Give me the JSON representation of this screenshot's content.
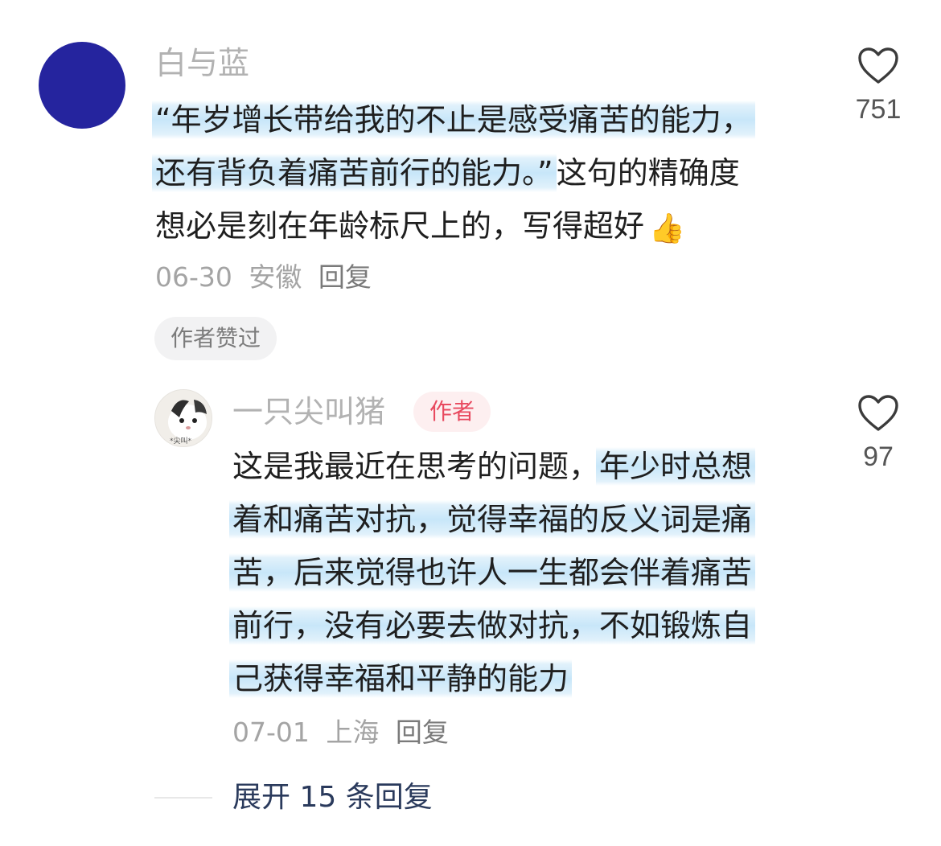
{
  "comment": {
    "username": "白与蓝",
    "avatar_color": "#25249e",
    "lines": [
      "“年岁增长带给我的不止是感受痛苦的能力，",
      "还有背负着痛苦前行的能力。”",
      "这句的精确度",
      "想必是刻在年龄标尺上的，写得超好"
    ],
    "emoji": "thumbs-up-icon",
    "date": "06-30",
    "location": "安徽",
    "reply_label": "回复",
    "like_count": "751",
    "author_liked_label": "作者赞过"
  },
  "reply": {
    "username": "一只尖叫猪",
    "author_badge": "作者",
    "lines": [
      "这是我最近在思考的问题，",
      "年少时总想",
      "着和痛苦对抗，觉得幸福的反义词是痛",
      "苦，后来觉得也许人一生都会伴着痛苦",
      "前行，没有必要去做对抗，不如锻炼自",
      "己获得幸福和平静的能力"
    ],
    "date": "07-01",
    "location": "上海",
    "reply_label": "回复",
    "like_count": "97"
  },
  "expand": {
    "label": "展开 15 条回复"
  },
  "colors": {
    "highlight": "#c4e4f8",
    "author_badge_text": "#e84a5f",
    "expand_text": "#2a3a5c"
  }
}
